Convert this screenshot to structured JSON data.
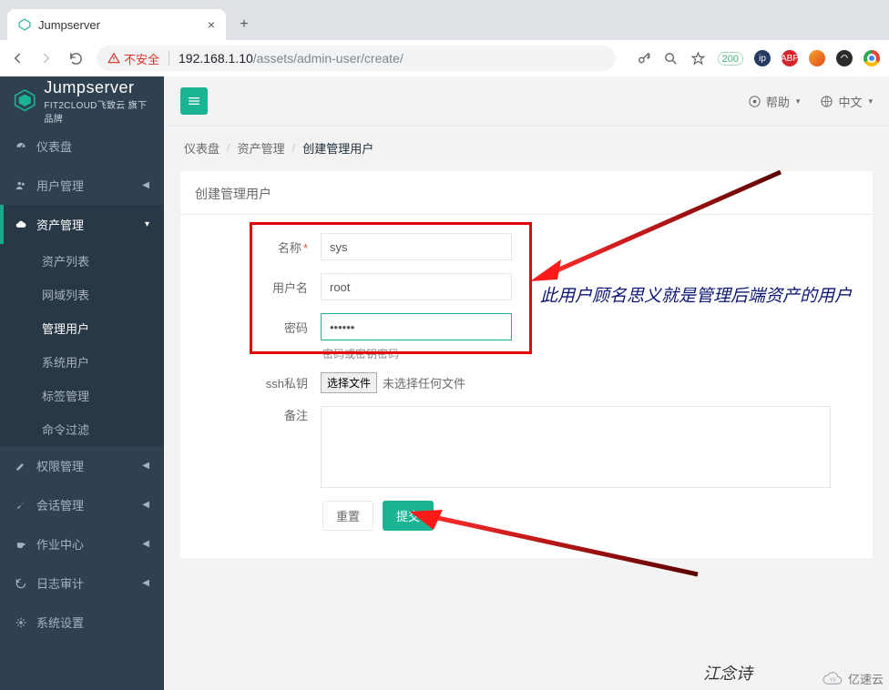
{
  "browser": {
    "tab_title": "Jumpserver",
    "insecure_label": "不安全",
    "url_host": "192.168.1.10",
    "url_path": "/assets/admin-user/create/",
    "badge200": "200"
  },
  "brand": {
    "name": "Jumpserver",
    "sub": "FIT2CLOUD飞致云  旗下品牌"
  },
  "topbar": {
    "help": "帮助",
    "lang": "中文"
  },
  "sidebar": {
    "dashboard": "仪表盘",
    "user_mgmt": "用户管理",
    "asset_mgmt": "资产管理",
    "asset_mgmt_sub": {
      "asset_list": "资产列表",
      "domain_list": "网域列表",
      "admin_user": "管理用户",
      "system_user": "系统用户",
      "label_mgmt": "标签管理",
      "cmd_filter": "命令过滤"
    },
    "perm_mgmt": "权限管理",
    "session_mgmt": "会话管理",
    "ops_center": "作业中心",
    "log_audit": "日志审计",
    "sys_setting": "系统设置"
  },
  "breadcrumb": {
    "b1": "仪表盘",
    "b2": "资产管理",
    "b3": "创建管理用户"
  },
  "form": {
    "panel_title": "创建管理用户",
    "name_label": "名称",
    "name_value": "sys",
    "user_label": "用户名",
    "user_value": "root",
    "pwd_label": "密码",
    "pwd_value": "••••••",
    "pwd_help": "密码或密钥密码",
    "ssh_label": "ssh私钥",
    "file_btn": "选择文件",
    "file_none": "未选择任何文件",
    "remark_label": "备注",
    "reset": "重置",
    "submit": "提交"
  },
  "annotation": {
    "text": "此用户顾名思义就是管理后端资产的用户"
  },
  "watermark": {
    "author": "江念诗",
    "site": "亿速云"
  }
}
